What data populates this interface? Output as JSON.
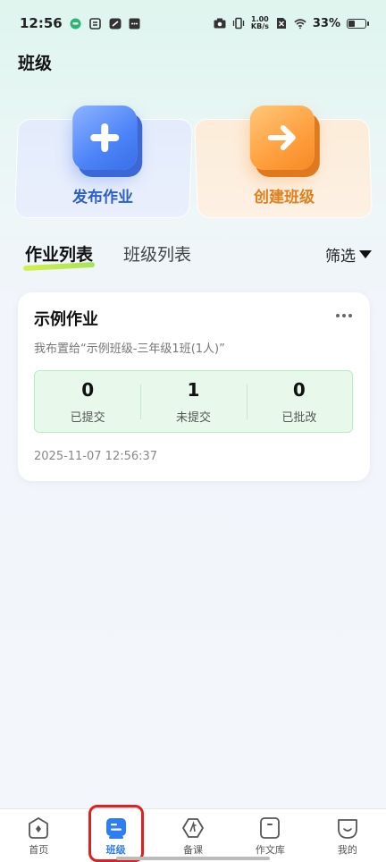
{
  "status_bar": {
    "time": "12:56",
    "net_speed_value": "1.00",
    "net_speed_unit": "KB/s",
    "battery": "33%",
    "battery_level": 0.33
  },
  "page_title": "班级",
  "actions": {
    "publish_label": "发布作业",
    "create_label": "创建班级"
  },
  "tabs": [
    {
      "label": "作业列表",
      "active": true
    },
    {
      "label": "班级列表",
      "active": false
    }
  ],
  "filter_label": "筛选",
  "homework": {
    "title": "示例作业",
    "desc": "我布置给“示例班级-三年级1班(1人)”",
    "stats": [
      {
        "value": "0",
        "label": "已提交"
      },
      {
        "value": "1",
        "label": "未提交"
      },
      {
        "value": "0",
        "label": "已批改"
      }
    ],
    "time": "2025-11-07 12:56:37"
  },
  "bottom_nav": [
    {
      "label": "首页",
      "icon": "home-icon",
      "active": false
    },
    {
      "label": "班级",
      "icon": "class-icon",
      "active": true
    },
    {
      "label": "备课",
      "icon": "prepare-lesson-icon",
      "active": false
    },
    {
      "label": "作文库",
      "icon": "essay-library-icon",
      "active": false
    },
    {
      "label": "我的",
      "icon": "profile-icon",
      "active": false
    }
  ],
  "colors": {
    "primary_blue": "#2e7cf6",
    "publish_text": "#2c5fc9",
    "create_text": "#e2801c",
    "stats_bg": "#e8f9ec",
    "highlight_red": "#e01f1f"
  }
}
